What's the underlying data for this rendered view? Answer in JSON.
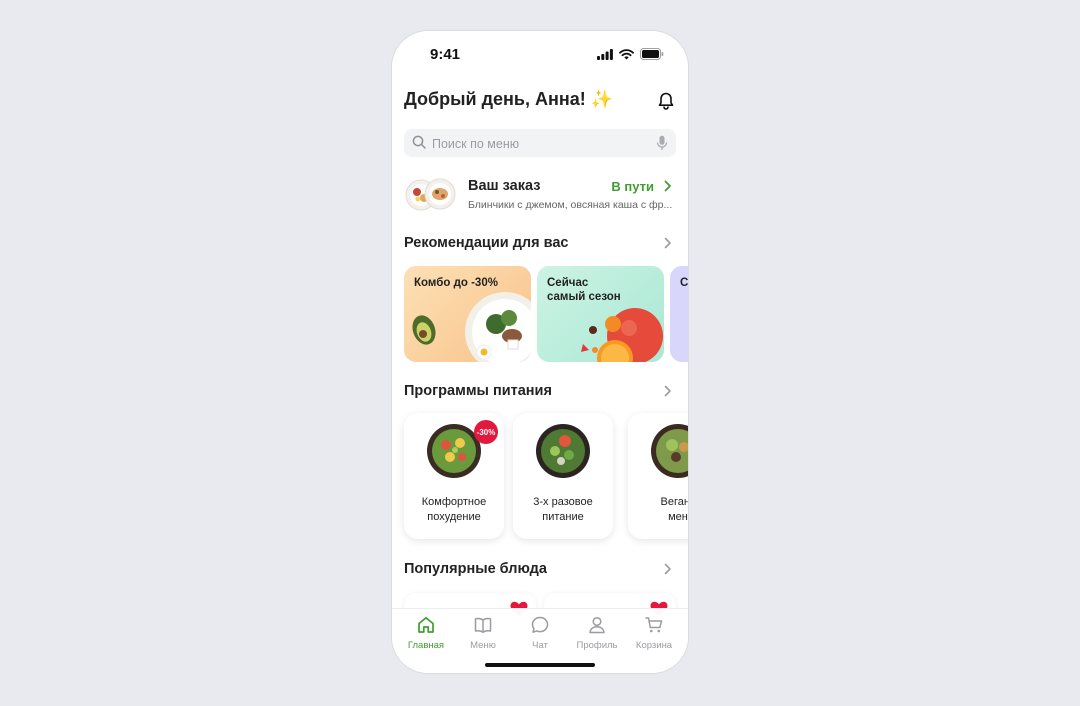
{
  "status_bar": {
    "time": "9:41"
  },
  "header": {
    "greeting": "Добрый день, Анна!",
    "sparkle": "✨"
  },
  "search": {
    "placeholder": "Поиск по меню",
    "value": ""
  },
  "order": {
    "title": "Ваш заказ",
    "status": "В пути",
    "description": "Блинчики с джемом, овсяная каша с фр..."
  },
  "recommendations": {
    "title": "Рекомендации для вас",
    "cards": [
      {
        "label": "Комбо до -30%"
      },
      {
        "label_line1": "Сейчас",
        "label_line2": "самый сезон"
      },
      {
        "label": "С"
      }
    ]
  },
  "programs": {
    "title": "Программы питания",
    "items": [
      {
        "line1": "Комфортное",
        "line2": "похудение",
        "badge": "-30%"
      },
      {
        "line1": "3-х разовое",
        "line2": "питание"
      },
      {
        "line1": "Веганс",
        "line2": "мен"
      }
    ]
  },
  "popular": {
    "title": "Популярные блюда"
  },
  "tabbar": {
    "items": [
      {
        "label": "Главная",
        "icon": "home-icon",
        "active": true
      },
      {
        "label": "Меню",
        "icon": "book-icon"
      },
      {
        "label": "Чат",
        "icon": "chat-icon"
      },
      {
        "label": "Профиль",
        "icon": "profile-icon"
      },
      {
        "label": "Корзина",
        "icon": "cart-icon"
      }
    ]
  },
  "colors": {
    "accent_green": "#3f9e2f",
    "badge_red": "#e3183d",
    "promo_orange": "#fbd2a2",
    "promo_mint": "#bfeede",
    "promo_lavender": "#d9d6fb"
  }
}
